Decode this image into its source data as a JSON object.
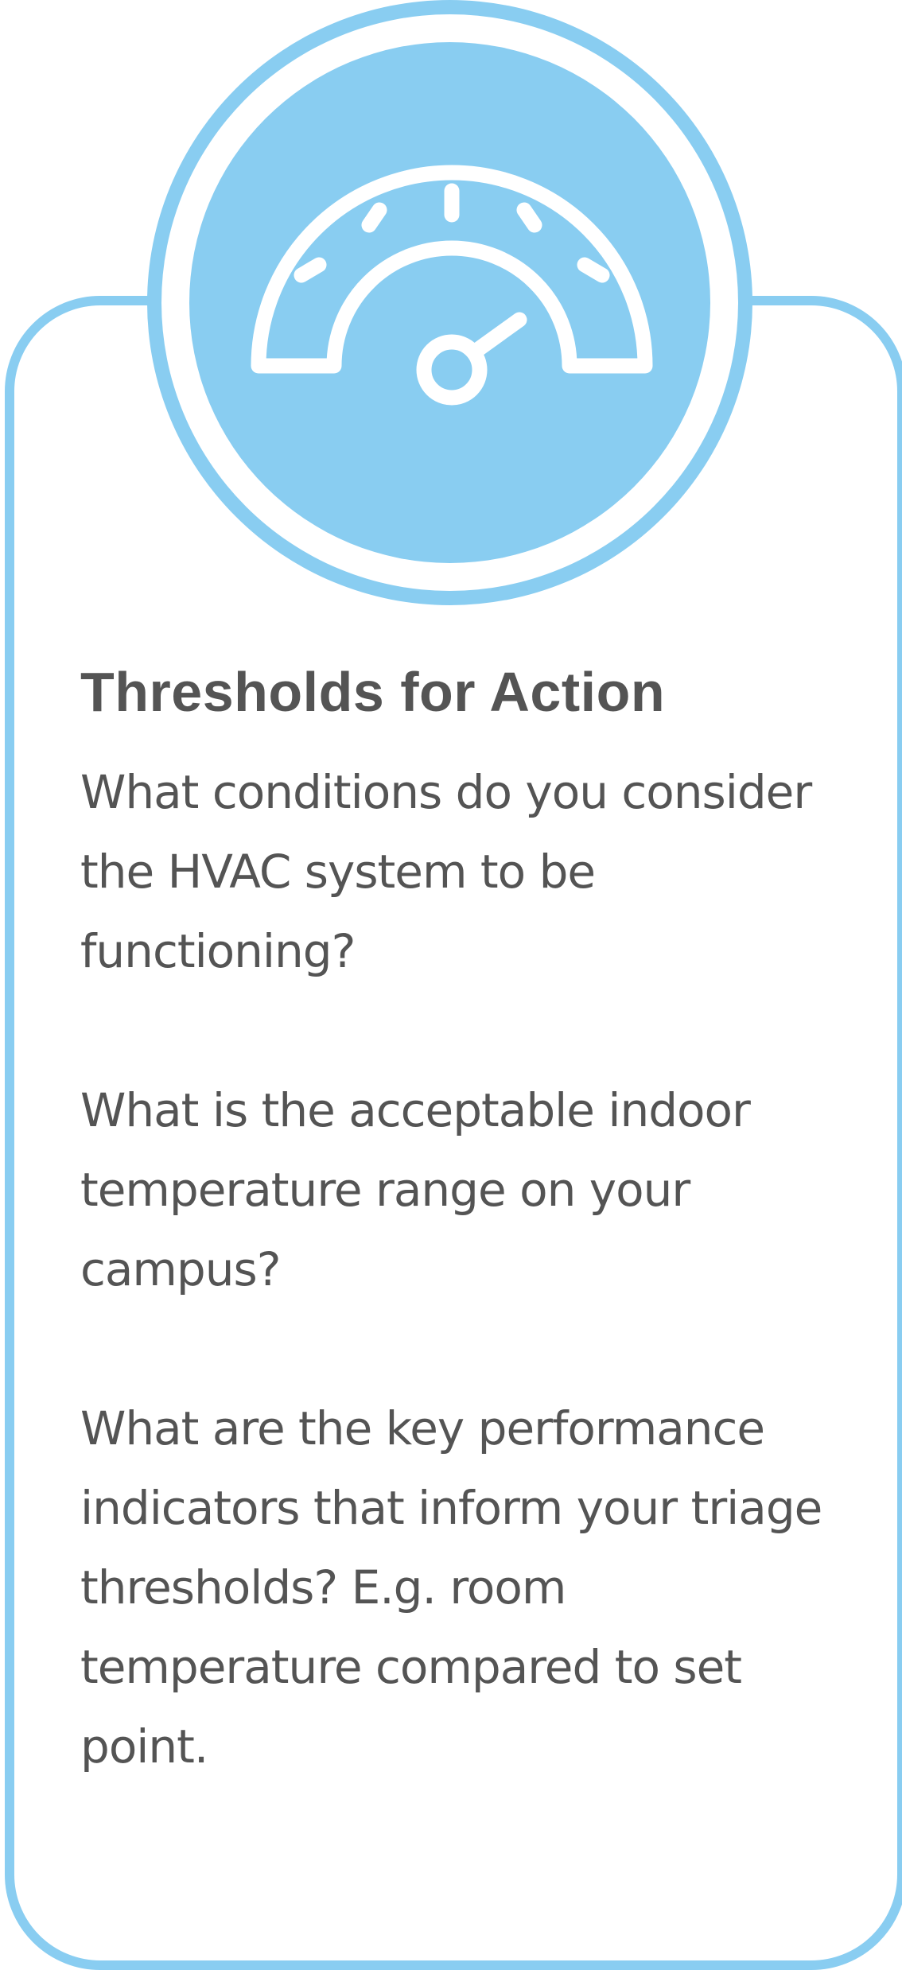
{
  "colors": {
    "accent": "#89CDF1",
    "text": "#545454",
    "background": "#FFFFFF"
  },
  "badge": {
    "icon": "speedometer-gauge-icon"
  },
  "card": {
    "title": "Thresholds for Action",
    "paragraphs": [
      "What conditions do you consider the HVAC system to be functioning?",
      "What is the acceptable indoor temperature range on your campus?",
      "What are the key performance indicators that inform your triage thresholds? E.g. room temperature compared to set point."
    ]
  }
}
